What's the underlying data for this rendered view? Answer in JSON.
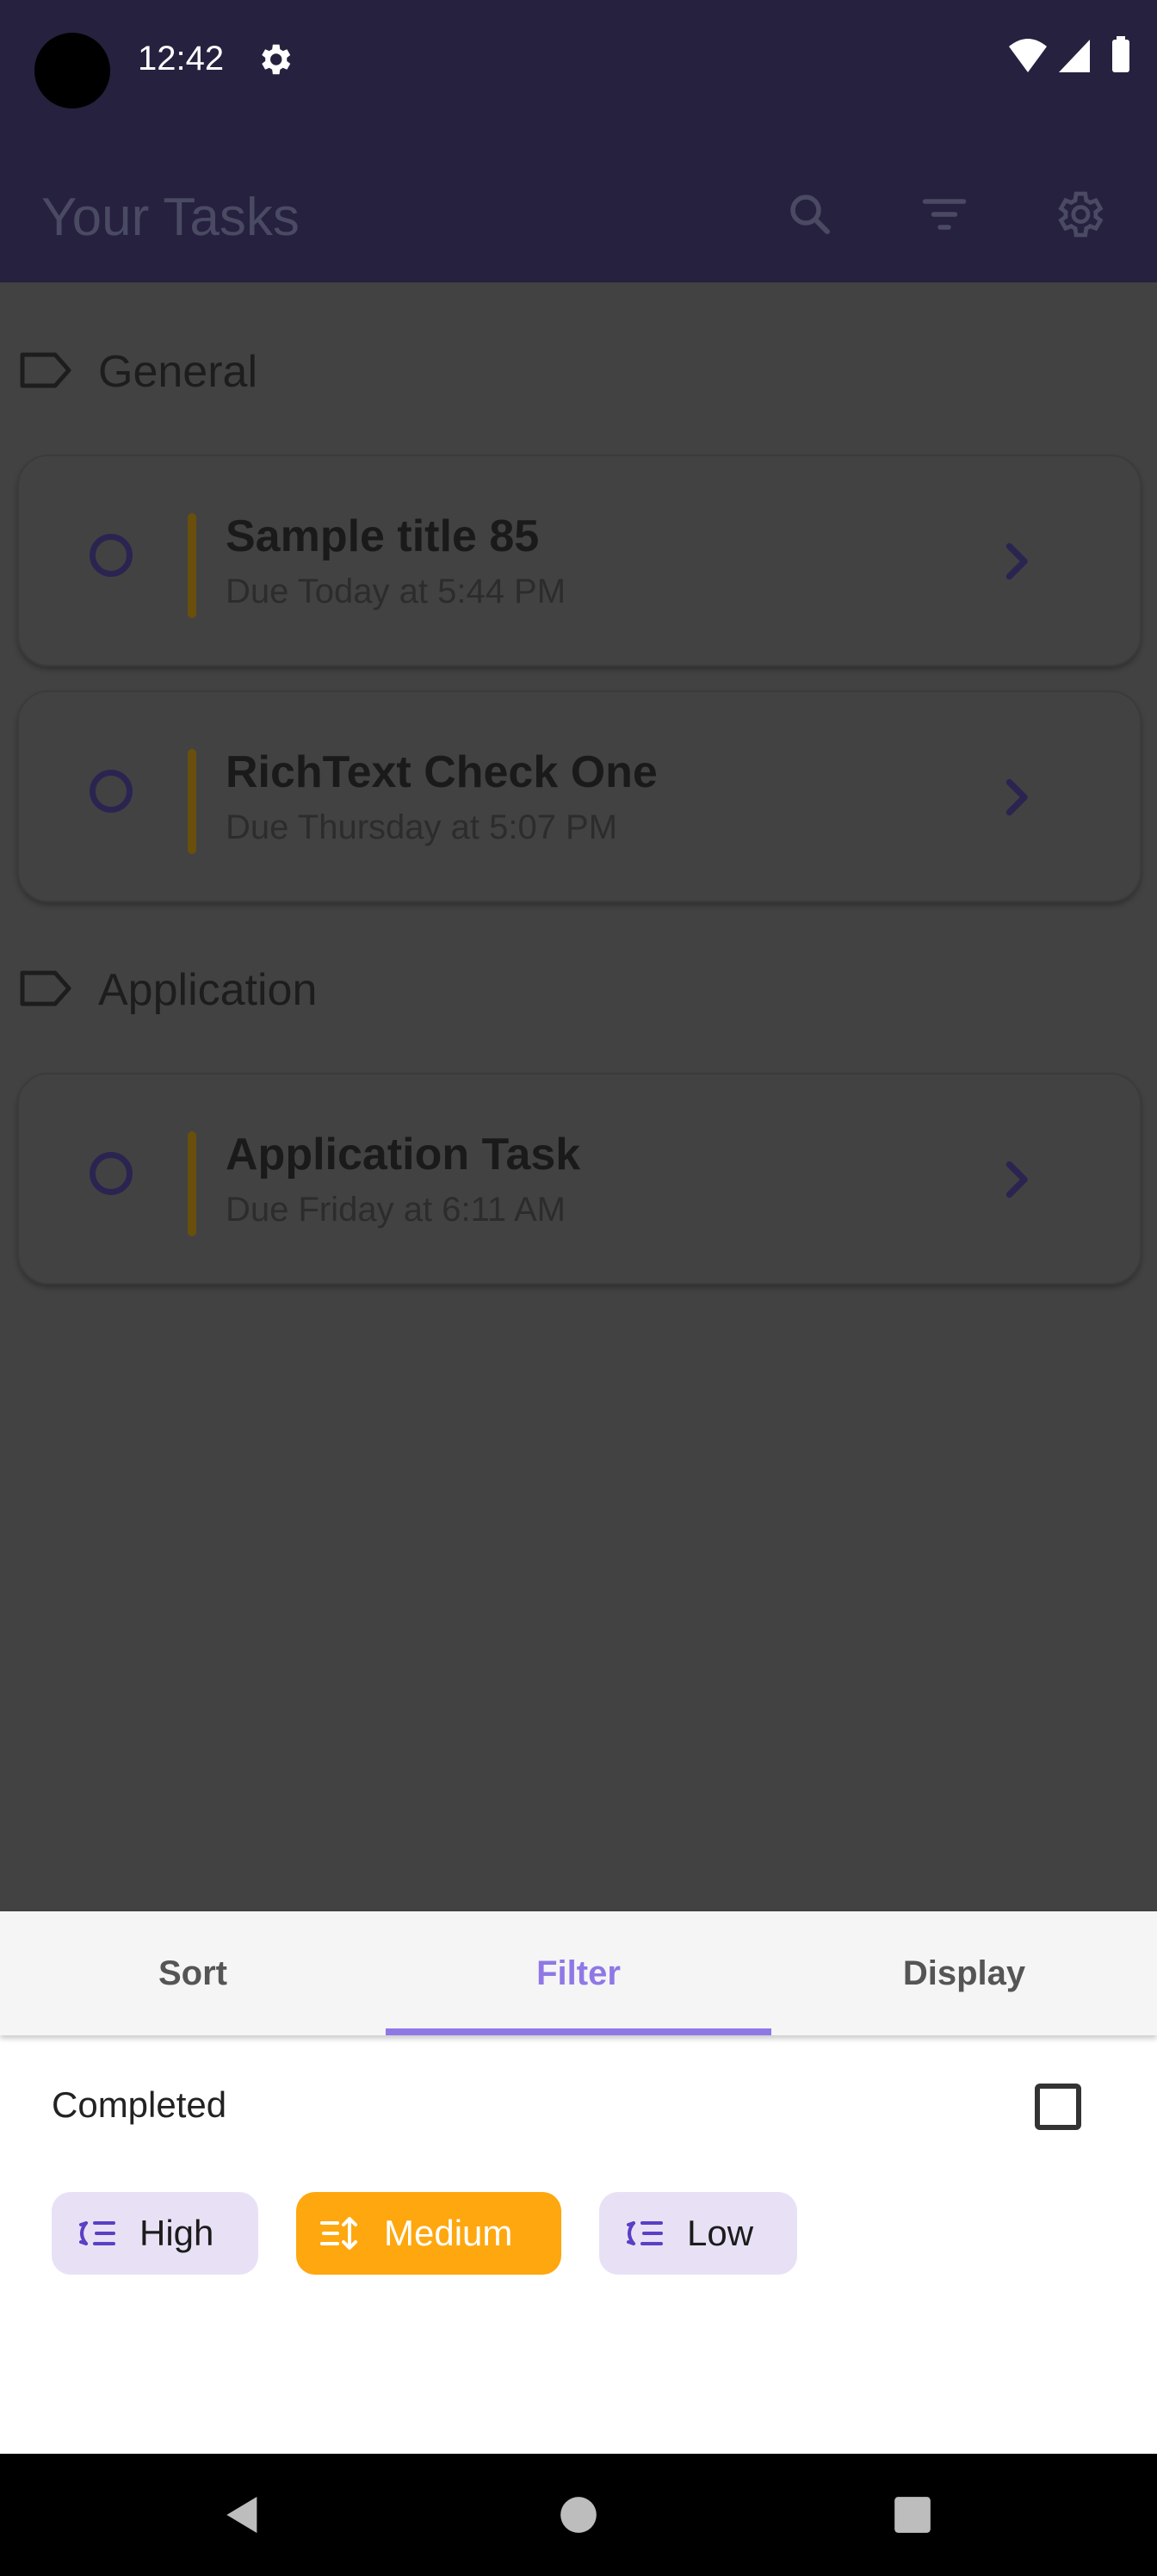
{
  "status_bar": {
    "time": "12:42"
  },
  "app_bar": {
    "title": "Your Tasks"
  },
  "sections": [
    {
      "title": "General",
      "tasks": [
        {
          "title": "Sample title 85",
          "due": "Due Today at 5:44 PM"
        },
        {
          "title": "RichText Check One",
          "due": "Due Thursday at 5:07 PM"
        }
      ]
    },
    {
      "title": "Application",
      "tasks": [
        {
          "title": "Application Task",
          "due": "Due Friday at 6:11 AM"
        }
      ]
    }
  ],
  "bottom_sheet": {
    "tabs": [
      {
        "label": "Sort"
      },
      {
        "label": "Filter"
      },
      {
        "label": "Display"
      }
    ],
    "active_tab": "Filter",
    "completed_label": "Completed",
    "completed_checked": false,
    "priority_chips": [
      {
        "label": "High",
        "selected": false
      },
      {
        "label": "Medium",
        "selected": true
      },
      {
        "label": "Low",
        "selected": false
      }
    ]
  },
  "colors": {
    "app_bar": "#25213f",
    "accent": "#8f78e6",
    "chip_selected": "#ffa70f",
    "chip_unselected": "#e8e1f6"
  }
}
